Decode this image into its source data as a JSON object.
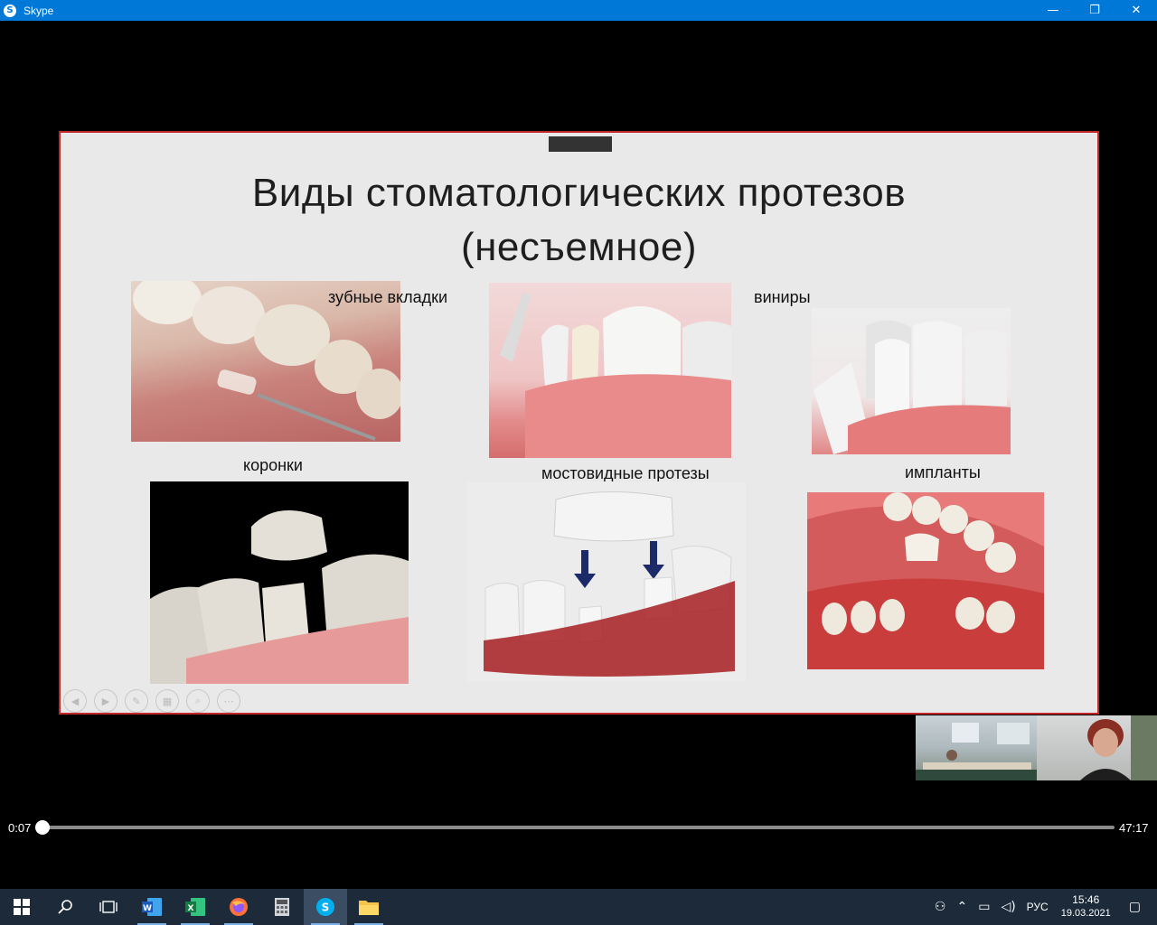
{
  "window": {
    "app_icon": "skype-icon",
    "title": "Skype",
    "minimize": "—",
    "maximize": "❐",
    "close": "✕"
  },
  "slide": {
    "title_line1": "Виды стоматологических протезов",
    "title_line2": "(несъемное)",
    "labels": {
      "inlays": "зубные вкладки",
      "veneers": "виниры",
      "crowns": "коронки",
      "bridges": "мостовидные протезы",
      "implants": "импланты"
    },
    "nav_icons": [
      "prev-icon",
      "next-icon",
      "pen-icon",
      "slides-icon",
      "zoom-icon",
      "more-icon"
    ]
  },
  "player": {
    "current_time": "0:07",
    "total_time": "47:17",
    "progress_fraction": 0.0025
  },
  "taskbar": {
    "apps": [
      "windows-start-icon",
      "search-icon",
      "task-view-icon",
      "word-icon",
      "excel-icon",
      "firefox-icon",
      "calculator-icon",
      "skype-icon",
      "file-explorer-icon"
    ],
    "tray": {
      "language": "РУС",
      "time": "15:46",
      "date": "19.03.2021"
    }
  },
  "colors": {
    "titlebar": "#0078d7",
    "slide_border": "#c0282a",
    "taskbar": "#1c2a3a"
  }
}
